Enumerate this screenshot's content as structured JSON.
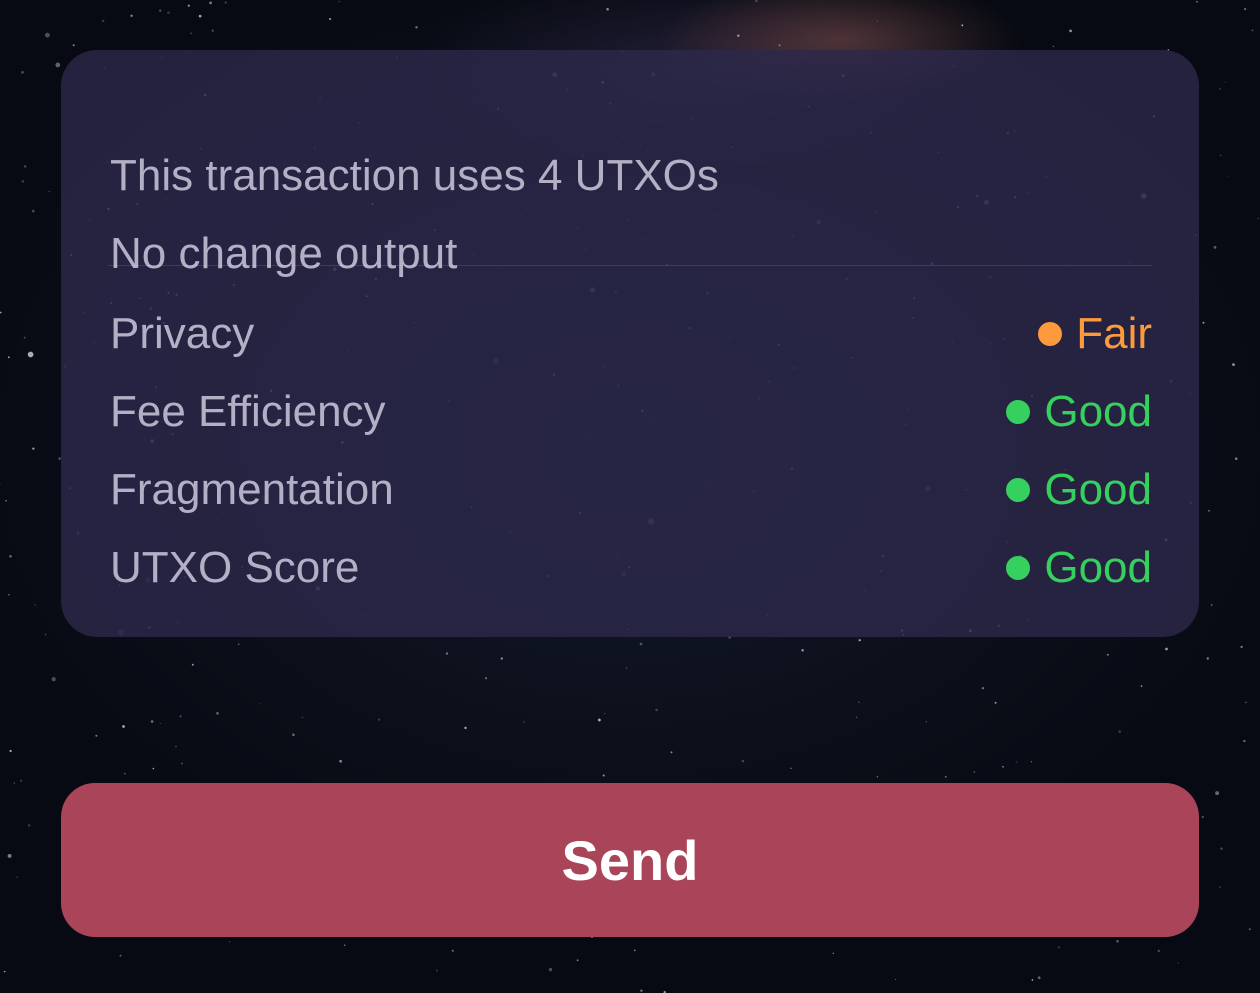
{
  "summary": {
    "utxo_line": "This transaction uses 4 UTXOs",
    "change_line": "No change output"
  },
  "metrics": [
    {
      "label": "Privacy",
      "value": "Fair",
      "status_color": "#fd9a3c"
    },
    {
      "label": "Fee Efficiency",
      "value": "Good",
      "status_color": "#35d05d"
    },
    {
      "label": "Fragmentation",
      "value": "Good",
      "status_color": "#35d05d"
    },
    {
      "label": "UTXO Score",
      "value": "Good",
      "status_color": "#35d05d"
    }
  ],
  "actions": {
    "send_label": "Send",
    "send_color": "#aa4459"
  }
}
